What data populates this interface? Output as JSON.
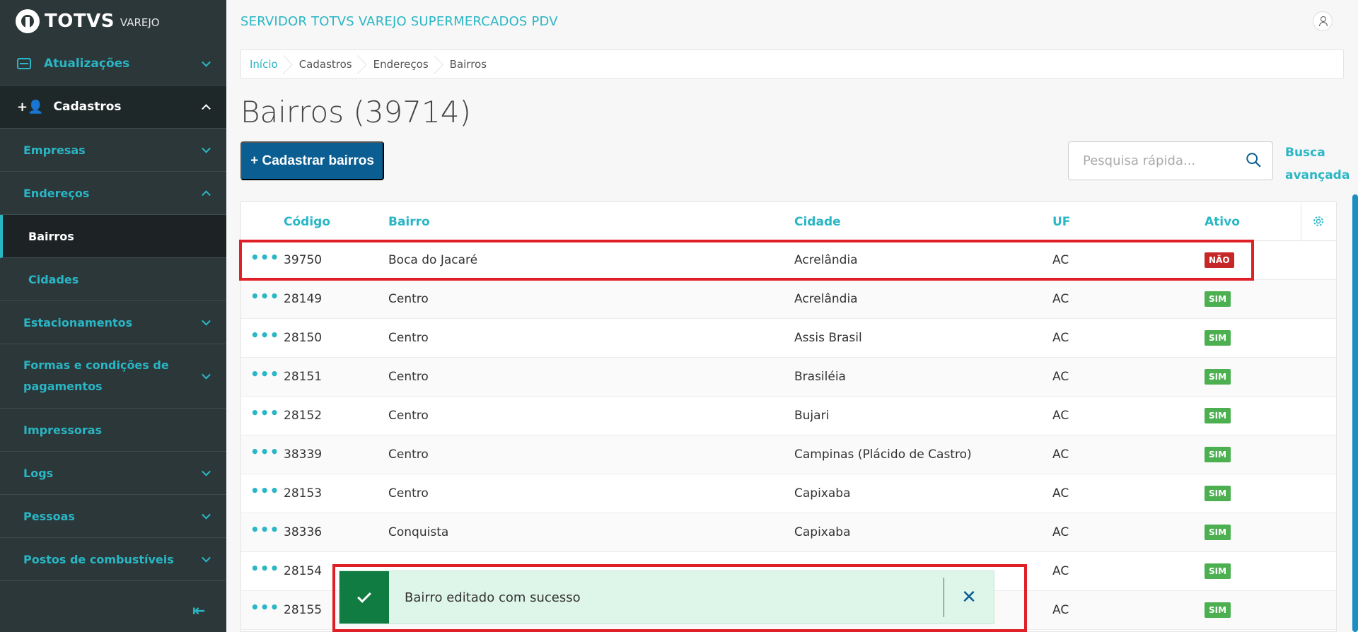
{
  "brand": {
    "name": "TOTVS",
    "sub": "VAREJO"
  },
  "header": {
    "server_title": "SERVIDOR TOTVS VAREJO SUPERMERCADOS PDV"
  },
  "sidebar": {
    "items": [
      {
        "label": "Atualizações"
      },
      {
        "label": "Cadastros"
      },
      {
        "label": "Empresas"
      },
      {
        "label": "Endereços"
      },
      {
        "label": "Bairros"
      },
      {
        "label": "Cidades"
      },
      {
        "label": "Estacionamentos"
      },
      {
        "label": "Formas e condições de pagamentos"
      },
      {
        "label": "Impressoras"
      },
      {
        "label": "Logs"
      },
      {
        "label": "Pessoas"
      },
      {
        "label": "Postos de combustíveis"
      }
    ]
  },
  "breadcrumb": [
    "Início",
    "Cadastros",
    "Endereços",
    "Bairros"
  ],
  "page": {
    "title": "Bairros (39714)",
    "add_button": "+ Cadastrar bairros",
    "search_placeholder": "Pesquisa rápida...",
    "advanced_search": [
      "Busca",
      "avançada"
    ]
  },
  "table": {
    "columns": [
      "Código",
      "Bairro",
      "Cidade",
      "UF",
      "Ativo"
    ],
    "rows": [
      {
        "codigo": "39750",
        "bairro": "Boca do Jacaré",
        "cidade": "Acrelândia",
        "uf": "AC",
        "ativo": "NÃO"
      },
      {
        "codigo": "28149",
        "bairro": "Centro",
        "cidade": "Acrelândia",
        "uf": "AC",
        "ativo": "SIM"
      },
      {
        "codigo": "28150",
        "bairro": "Centro",
        "cidade": "Assis Brasil",
        "uf": "AC",
        "ativo": "SIM"
      },
      {
        "codigo": "28151",
        "bairro": "Centro",
        "cidade": "Brasiléia",
        "uf": "AC",
        "ativo": "SIM"
      },
      {
        "codigo": "28152",
        "bairro": "Centro",
        "cidade": "Bujari",
        "uf": "AC",
        "ativo": "SIM"
      },
      {
        "codigo": "38339",
        "bairro": "Centro",
        "cidade": "Campinas (Plácido de Castro)",
        "uf": "AC",
        "ativo": "SIM"
      },
      {
        "codigo": "28153",
        "bairro": "Centro",
        "cidade": "Capixaba",
        "uf": "AC",
        "ativo": "SIM"
      },
      {
        "codigo": "38336",
        "bairro": "Conquista",
        "cidade": "Capixaba",
        "uf": "AC",
        "ativo": "SIM"
      },
      {
        "codigo": "28154",
        "bairro": "",
        "cidade": "",
        "uf": "AC",
        "ativo": "SIM"
      },
      {
        "codigo": "28155",
        "bairro": "",
        "cidade": "",
        "uf": "AC",
        "ativo": "SIM"
      }
    ]
  },
  "toast": {
    "message": "Bairro editado com sucesso",
    "close": "✕"
  },
  "icons": {
    "row_actions": "•••"
  },
  "colors": {
    "accent": "#29b6c5",
    "primary": "#0b5e91",
    "sidebar": "#2c3739",
    "success": "#4caf50",
    "danger": "#c62828",
    "highlight": "#e02027"
  }
}
